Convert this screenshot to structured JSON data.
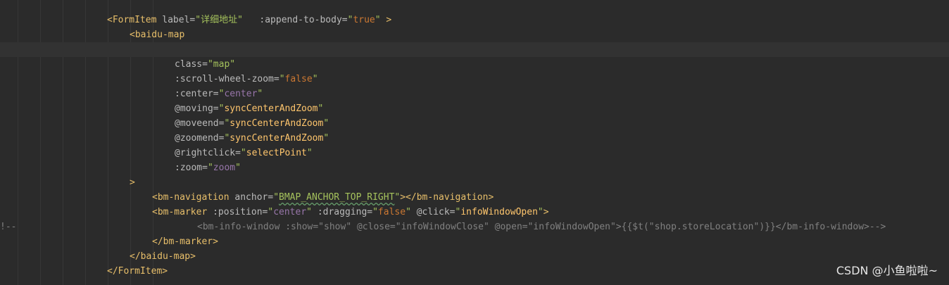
{
  "editor": {
    "lines": [
      {
        "id": "l1",
        "segments": [
          [
            "tag",
            "<FormItem"
          ],
          [
            "attr",
            " label="
          ],
          [
            "str",
            "\"详细地址\""
          ],
          [
            "attr",
            "   :append-to-body="
          ],
          [
            "str",
            "\""
          ],
          [
            "bool",
            "true"
          ],
          [
            "str",
            "\""
          ],
          [
            "tag",
            " >"
          ]
        ]
      },
      {
        "id": "l2",
        "segments": [
          [
            "tag",
            "<baidu-map"
          ]
        ]
      },
      {
        "id": "l3",
        "segments": []
      },
      {
        "id": "l4",
        "segments": [
          [
            "attr",
            "class="
          ],
          [
            "str",
            "\"map\""
          ]
        ]
      },
      {
        "id": "l5",
        "segments": [
          [
            "attr",
            ":scroll-wheel-zoom="
          ],
          [
            "str",
            "\""
          ],
          [
            "bool",
            "false"
          ],
          [
            "str",
            "\""
          ]
        ]
      },
      {
        "id": "l6",
        "segments": [
          [
            "attr",
            ":center="
          ],
          [
            "str",
            "\""
          ],
          [
            "var",
            "center"
          ],
          [
            "str",
            "\""
          ]
        ]
      },
      {
        "id": "l7",
        "segments": [
          [
            "attr",
            "@moving="
          ],
          [
            "str",
            "\""
          ],
          [
            "strb",
            "syncCenterAndZoom"
          ],
          [
            "str",
            "\""
          ]
        ]
      },
      {
        "id": "l8",
        "segments": [
          [
            "attr",
            "@moveend="
          ],
          [
            "str",
            "\""
          ],
          [
            "strb",
            "syncCenterAndZoom"
          ],
          [
            "str",
            "\""
          ]
        ]
      },
      {
        "id": "l9",
        "segments": [
          [
            "attr",
            "@zoomend="
          ],
          [
            "str",
            "\""
          ],
          [
            "strb",
            "syncCenterAndZoom"
          ],
          [
            "str",
            "\""
          ]
        ]
      },
      {
        "id": "l10",
        "segments": [
          [
            "attr",
            "@rightclick="
          ],
          [
            "str",
            "\""
          ],
          [
            "strb",
            "selectPoint"
          ],
          [
            "str",
            "\""
          ]
        ]
      },
      {
        "id": "l11",
        "segments": [
          [
            "attr",
            ":zoom="
          ],
          [
            "str",
            "\""
          ],
          [
            "var",
            "zoom"
          ],
          [
            "str",
            "\""
          ]
        ]
      },
      {
        "id": "l12",
        "segments": [
          [
            "tag",
            ">"
          ]
        ]
      },
      {
        "id": "l13",
        "segments": [
          [
            "tag",
            "<bm-navigation"
          ],
          [
            "attr",
            " anchor="
          ],
          [
            "str",
            "\""
          ],
          [
            "squig",
            "BMAP_ANCHOR_TOP_RIGHT"
          ],
          [
            "str",
            "\""
          ],
          [
            "tag",
            "></bm-navigation>"
          ]
        ]
      },
      {
        "id": "l14",
        "segments": [
          [
            "tag",
            "<bm-marker"
          ],
          [
            "attr",
            " :position="
          ],
          [
            "str",
            "\""
          ],
          [
            "var",
            "center"
          ],
          [
            "str",
            "\""
          ],
          [
            "attr",
            " :dragging="
          ],
          [
            "str",
            "\""
          ],
          [
            "bool",
            "false"
          ],
          [
            "str",
            "\""
          ],
          [
            "attr",
            " @click="
          ],
          [
            "str",
            "\""
          ],
          [
            "strb",
            "infoWindowOpen"
          ],
          [
            "str",
            "\""
          ],
          [
            "tag",
            ">"
          ]
        ]
      },
      {
        "id": "l15",
        "segments": [
          [
            "comment",
            "<bm-info-window :show=\"show\" @close=\"infoWindowClose\" @open=\"infoWindowOpen\">{{$t(\"shop.storeLocation\")}}</bm-info-window>-->"
          ]
        ]
      },
      {
        "id": "l16",
        "segments": [
          [
            "tag",
            "</bm-marker>"
          ]
        ]
      },
      {
        "id": "l17",
        "segments": [
          [
            "tag",
            "</baidu-map>"
          ]
        ]
      },
      {
        "id": "l18",
        "segments": [
          [
            "tag",
            "</FormItem>"
          ]
        ]
      }
    ],
    "comment_prefix": "!--"
  },
  "watermark": "CSDN @小鱼啦啦~"
}
